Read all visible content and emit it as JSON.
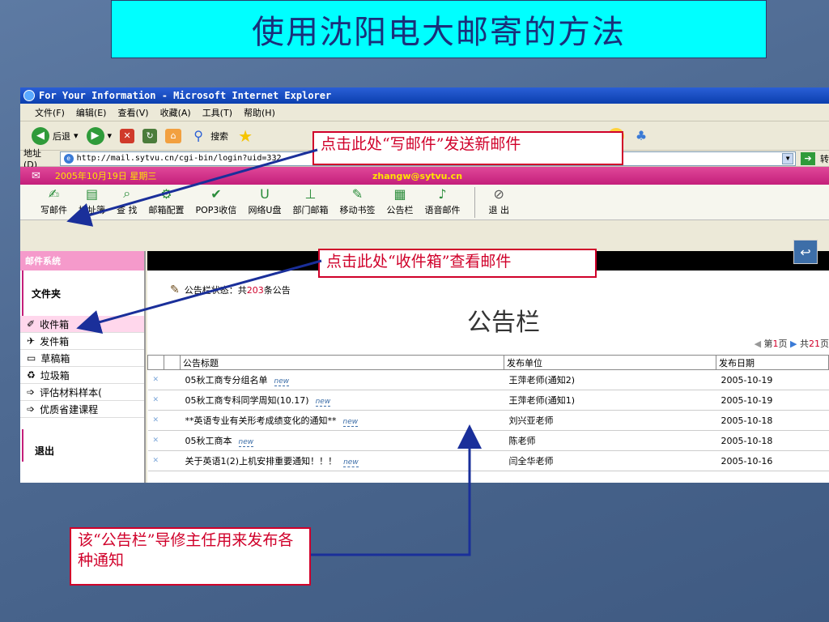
{
  "slide": {
    "title": "使用沈阳电大邮寄的方法"
  },
  "browser": {
    "window_title": "For Your Information - Microsoft Internet Explorer",
    "menu": [
      "文件(F)",
      "编辑(E)",
      "查看(V)",
      "收藏(A)",
      "工具(T)",
      "帮助(H)"
    ],
    "toolbar": {
      "back_label": "后退",
      "search_label": "搜索"
    },
    "address_label": "地址(D)",
    "address_value": "http://mail.sytvu.cn/cgi-bin/login?uid=332",
    "go_label": "转"
  },
  "mail": {
    "date": "2005年10月19日 星期三",
    "email": "zhangw@sytvu.cn",
    "toolbar": [
      "写邮件",
      "地址簿",
      "查 找",
      "邮箱配置",
      "POP3收信",
      "网络U盘",
      "部门邮箱",
      "移动书签",
      "公告栏",
      "语音邮件",
      "退 出"
    ],
    "sidebar": {
      "header": "邮件系统",
      "folders_title": "文件夹",
      "items": [
        "收件箱",
        "发件箱",
        "草稿箱",
        "垃圾箱",
        "评估材料样本(",
        "优质省建课程"
      ],
      "exit": "退出"
    },
    "board": {
      "status_prefix": "公告栏状态：共",
      "status_count": "203",
      "status_suffix": "条公告",
      "title": "公告栏",
      "pager_prefix": "第",
      "pager_page": "1",
      "pager_mid": "页",
      "pager_total_prefix": "共",
      "pager_total": "21",
      "pager_suffix": "页",
      "columns": [
        "公告标题",
        "发布单位",
        "发布日期"
      ],
      "rows": [
        {
          "title": "05秋工商专分组名单",
          "new": "new",
          "unit": "王萍老师(通知2)",
          "date": "2005-10-19"
        },
        {
          "title": "05秋工商专科同学周知(10.17)",
          "new": "new",
          "unit": "王萍老师(通知1)",
          "date": "2005-10-19"
        },
        {
          "title": "**英语专业有关形考成绩变化的通知**",
          "new": "new",
          "unit": "刘兴亚老师",
          "date": "2005-10-18"
        },
        {
          "title": "05秋工商本",
          "new": "new",
          "unit": "陈老师",
          "date": "2005-10-18"
        },
        {
          "title": "关于英语1(2)上机安排重要通知！！！",
          "new": "new",
          "unit": "闫全华老师",
          "date": "2005-10-16"
        }
      ]
    }
  },
  "callouts": {
    "compose": "点击此处“写邮件”发送新邮件",
    "inbox": "点击此处“收件箱”查看邮件",
    "board": "该“公告栏”导修主任用来发布各种通知"
  },
  "colors": {
    "title_bg": "#00ffff",
    "callout_border": "#d0002a",
    "arrow": "#1a2f9a"
  }
}
